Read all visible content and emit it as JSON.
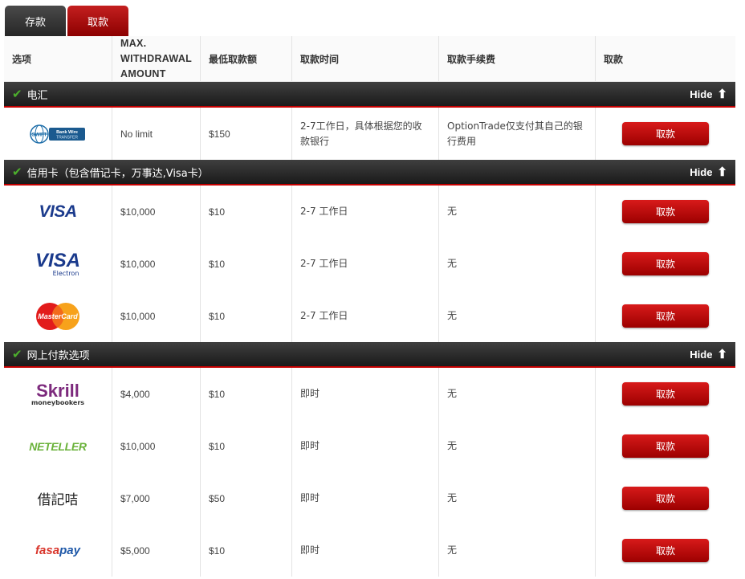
{
  "tabs": [
    "存款",
    "取款"
  ],
  "headers": {
    "option": "选项",
    "max_line1": "MAX.",
    "max_line2": "WITHDRAWAL",
    "max_line3": "AMOUNT",
    "min": "最低取款额",
    "time": "取款时间",
    "fee": "取款手续费",
    "action": "取款"
  },
  "hide_label": "Hide",
  "sections": [
    {
      "title": "电汇",
      "rows": [
        {
          "logo": "Bank Wire TRANSFER",
          "logo_icon": "swift-bank-wire-logo",
          "max": "No limit",
          "min": "$150",
          "time": "2-7工作日，具体根据您的收款银行",
          "fee": "OptionTrade仅支付其自己的银行费用",
          "button": "取款"
        }
      ]
    },
    {
      "title": "信用卡（包含借记卡，万事达,Visa卡）",
      "rows": [
        {
          "logo": "VISA",
          "logo_icon": "visa-logo",
          "max": "$10,000",
          "min": "$10",
          "time": "2-7 工作日",
          "fee": "无",
          "button": "取款"
        },
        {
          "logo": "VISA",
          "logo_sub": "Electron",
          "logo_icon": "visa-electron-logo",
          "max": "$10,000",
          "min": "$10",
          "time": "2-7 工作日",
          "fee": "无",
          "button": "取款"
        },
        {
          "logo": "MasterCard",
          "logo_icon": "mastercard-logo",
          "max": "$10,000",
          "min": "$10",
          "time": "2-7 工作日",
          "fee": "无",
          "button": "取款"
        }
      ]
    },
    {
      "title": "网上付款选项",
      "rows": [
        {
          "logo": "Skrill",
          "logo_sub": "moneybookers",
          "logo_icon": "skrill-logo",
          "max": "$4,000",
          "min": "$10",
          "time": "即时",
          "fee": "无",
          "button": "取款"
        },
        {
          "logo": "NETELLER",
          "logo_icon": "neteller-logo",
          "max": "$10,000",
          "min": "$10",
          "time": "即时",
          "fee": "无",
          "button": "取款"
        },
        {
          "logo": "借記咭",
          "logo_icon": "debit-card-text",
          "max": "$7,000",
          "min": "$50",
          "time": "即时",
          "fee": "无",
          "button": "取款"
        },
        {
          "logo": "fasapay",
          "logo_icon": "fasapay-logo",
          "max": "$5,000",
          "min": "$10",
          "time": "即时",
          "fee": "无",
          "button": "取款"
        }
      ]
    }
  ],
  "colors": {
    "accent_red": "#b30000",
    "section_bg": "#2a2a2a",
    "check_green": "#4caf2c"
  }
}
